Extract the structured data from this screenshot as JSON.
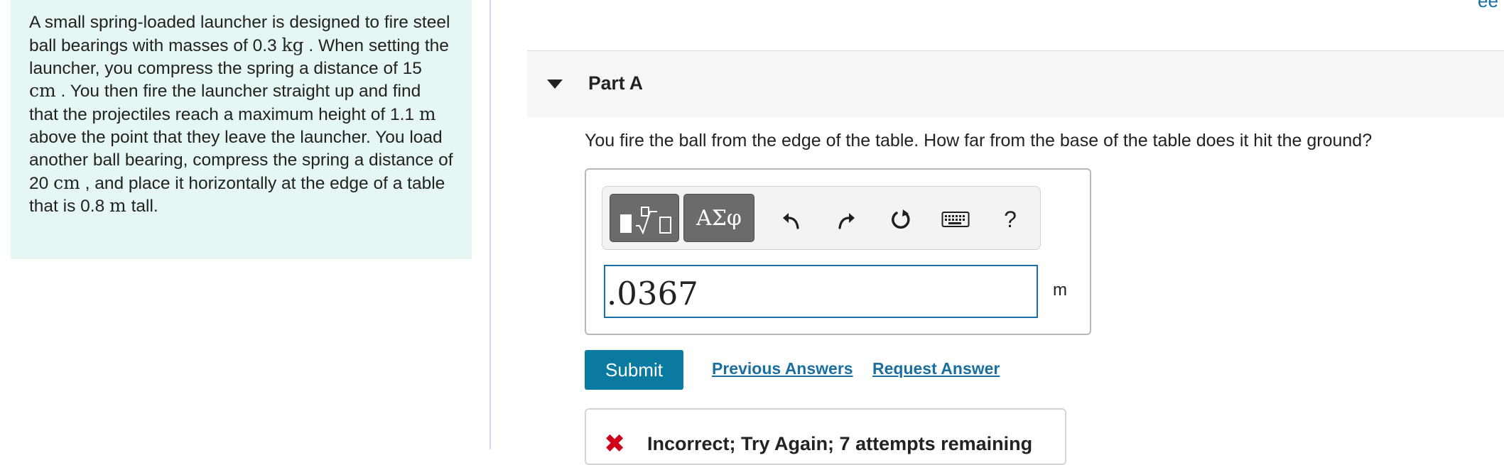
{
  "problem": {
    "segments": [
      {
        "t": "A small spring-loaded launcher is designed to fire steel ball bearings with masses of 0.3 ",
        "v": false
      },
      {
        "t": "kg",
        "v": true
      },
      {
        "t": " .  When setting the launcher, you compress the spring a distance of 15 ",
        "v": false
      },
      {
        "t": "cm",
        "v": true
      },
      {
        "t": " .  You then fire the launcher straight up and find that the projectiles reach a maximum height of 1.1 ",
        "v": false
      },
      {
        "t": "m",
        "v": true
      },
      {
        "t": " above the point that they leave the launcher.  You load another ball bearing, compress the spring a distance of 20 ",
        "v": false
      },
      {
        "t": "cm",
        "v": true
      },
      {
        "t": " , and place it horizontally at the edge of a table that is 0.8 ",
        "v": false
      },
      {
        "t": "m",
        "v": true
      },
      {
        "t": " tall.",
        "v": false
      }
    ]
  },
  "corner_glyph": "ee",
  "part": {
    "caret_icon": "caret-down-icon",
    "title": "Part A"
  },
  "question": "You fire the ball from the edge of the table.  How far from the base of the table does it hit the ground?",
  "toolbar": {
    "templates_icon": "math-templates-icon",
    "greek_label": "ΑΣφ",
    "undo_icon": "undo-icon",
    "redo_icon": "redo-icon",
    "reset_icon": "reset-icon",
    "keyboard_icon": "keyboard-icon",
    "help_label": "?"
  },
  "answer": {
    "value": ".0367",
    "unit": "m"
  },
  "actions": {
    "submit_label": "Submit",
    "previous_answers_label": "Previous Answers",
    "request_answer_label": "Request Answer"
  },
  "feedback": {
    "icon": "incorrect-x-icon",
    "text": "Incorrect; Try Again; 7 attempts remaining"
  },
  "colors": {
    "problem_bg": "#e6f6f5",
    "accent": "#0a7aa1",
    "link": "#1a6fa0",
    "error": "#d0021b"
  }
}
